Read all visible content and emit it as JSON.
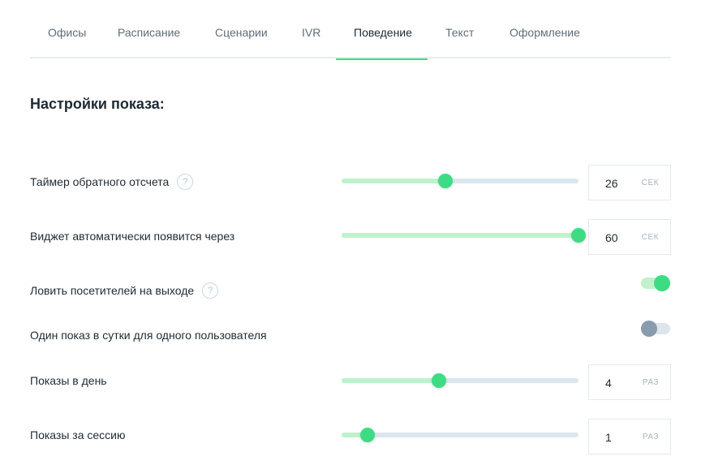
{
  "tabs": [
    {
      "label": "Офисы"
    },
    {
      "label": "Расписание"
    },
    {
      "label": "Сценарии"
    },
    {
      "label": "IVR"
    },
    {
      "label": "Поведение"
    },
    {
      "label": "Текст"
    },
    {
      "label": "Оформление"
    }
  ],
  "active_tab": "Поведение",
  "section_title": "Настройки показа:",
  "settings": {
    "timer": {
      "label": "Таймер обратного отсчета",
      "help": "?",
      "value": "26",
      "unit": "СЕК",
      "level": 0.44
    },
    "auto_show": {
      "label": "Виджет автоматически появится через",
      "value": "60",
      "unit": "СЕК",
      "level": 1.0
    },
    "exit_intent": {
      "label": "Ловить посетителей на выходе",
      "help": "?",
      "enabled": true
    },
    "once_per_day": {
      "label": "Один показ в сутки для одного пользователя",
      "enabled": false
    },
    "per_day": {
      "label": "Показы в день",
      "value": "4",
      "unit": "РАЗ",
      "level": 0.41
    },
    "per_session": {
      "label": "Показы за сессию",
      "value": "1",
      "unit": "РАЗ",
      "level": 0.11
    }
  },
  "colors": {
    "accent": "#3ddc84",
    "accent_light": "#bff2cc",
    "track": "#dbe6ef",
    "toggle_off_knob": "#8a9bb0"
  }
}
